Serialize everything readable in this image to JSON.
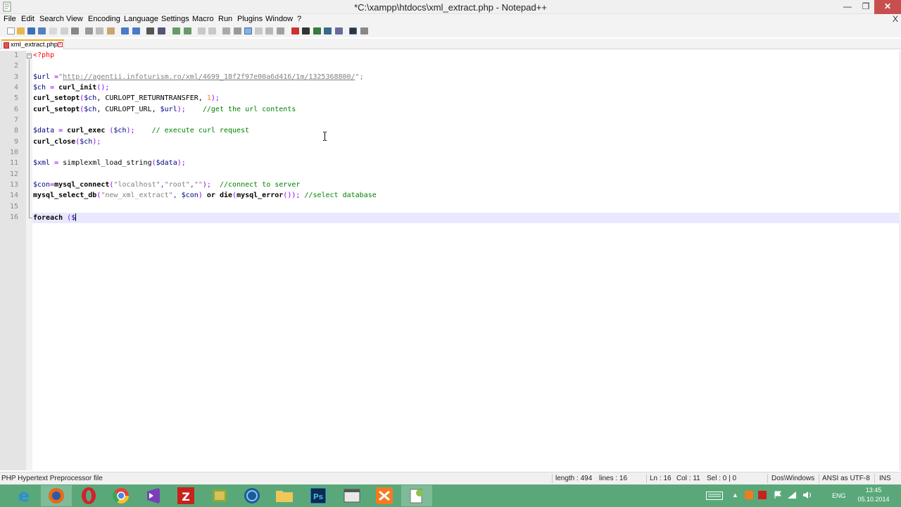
{
  "window": {
    "title": "*C:\\xampp\\htdocs\\xml_extract.php - Notepad++",
    "min_glyph": "—",
    "max_glyph": "❐",
    "close_glyph": "✕"
  },
  "menu": {
    "items": [
      "File",
      "Edit",
      "Search",
      "View",
      "Encoding",
      "Language",
      "Settings",
      "Macro",
      "Run",
      "Plugins",
      "Window",
      "?"
    ],
    "close_document": "X"
  },
  "tabs": [
    {
      "label": "xml_extract.php",
      "close_glyph": "x"
    }
  ],
  "editor": {
    "lines": [
      {
        "n": "1"
      },
      {
        "n": "2"
      },
      {
        "n": "3"
      },
      {
        "n": "4"
      },
      {
        "n": "5"
      },
      {
        "n": "6"
      },
      {
        "n": "7"
      },
      {
        "n": "8"
      },
      {
        "n": "9"
      },
      {
        "n": "10"
      },
      {
        "n": "11"
      },
      {
        "n": "12"
      },
      {
        "n": "13"
      },
      {
        "n": "14"
      },
      {
        "n": "15"
      },
      {
        "n": "16"
      }
    ],
    "fold_glyph": "−",
    "code": {
      "l1_open": "<?php",
      "l3_var": "$url",
      "l3_eq": " =",
      "l3_q1": "\"",
      "l3_url": "http://agentii.infoturism.ro/xml/4699_18f2f97e00a6d416/1m/1325368800/",
      "l3_end": "\";",
      "l4_var": "$ch",
      "l4_eq": " = ",
      "l4_fn": "curl_init",
      "l4_end": "();",
      "l5_fn": "curl_setopt",
      "l5_a": "(",
      "l5_var": "$ch",
      "l5_b": ", CURLOPT_RETURNTRANSFER, ",
      "l5_num": "1",
      "l5_end": ");",
      "l6_fn": "curl_setopt",
      "l6_a": "(",
      "l6_var": "$ch",
      "l6_b": ", CURLOPT_URL, ",
      "l6_var2": "$url",
      "l6_end": ");    ",
      "l6_cmt": "//get the url contents",
      "l8_var": "$data",
      "l8_eq": " = ",
      "l8_fn": "curl_exec",
      "l8_a": " (",
      "l8_var2": "$ch",
      "l8_end": ");    ",
      "l8_cmt": "// execute curl request",
      "l9_fn": "curl_close",
      "l9_a": "(",
      "l9_var": "$ch",
      "l9_end": ");",
      "l11_var": "$xml",
      "l11_eq": " = ",
      "l11_fn": "simplexml_load_string",
      "l11_a": "(",
      "l11_var2": "$data",
      "l11_end": ");",
      "l13_var": "$con",
      "l13_eq": "=",
      "l13_fn": "mysql_connect",
      "l13_a": "(",
      "l13_s1": "\"localhost\"",
      "l13_c1": ",",
      "l13_s2": "\"root\"",
      "l13_c2": ",",
      "l13_s3": "\"\"",
      "l13_end": ");  ",
      "l13_cmt": "//connect to server",
      "l14_fn": "mysql_select_db",
      "l14_a": "(",
      "l14_s1": "\"new_xml_extract\"",
      "l14_c1": ", ",
      "l14_var": "$con",
      "l14_b": ") ",
      "l14_or": "or",
      "l14_sp": " ",
      "l14_die": "die",
      "l14_c": "(",
      "l14_fn2": "mysql_error",
      "l14_end": "()); ",
      "l14_cmt": "//select database",
      "l16_kw": "foreach",
      "l16_a": " (",
      "l16_var": "$"
    }
  },
  "status": {
    "file_type": "PHP Hypertext Preprocessor file",
    "length": "length : 494",
    "lines": "lines : 16",
    "ln": "Ln : 16",
    "col": "Col : 11",
    "sel": "Sel : 0 | 0",
    "eol": "Dos\\Windows",
    "encoding": "ANSI as UTF-8",
    "mode": "INS"
  },
  "taskbar": {
    "lang": "ENG",
    "time": "13:45",
    "date": "05.10.2014",
    "apps": [
      "internet-explorer",
      "firefox",
      "opera",
      "chrome",
      "visual-studio",
      "filezilla",
      "game",
      "network",
      "file-explorer",
      "photoshop",
      "terminal",
      "xampp",
      "notepad-plus-plus"
    ]
  }
}
